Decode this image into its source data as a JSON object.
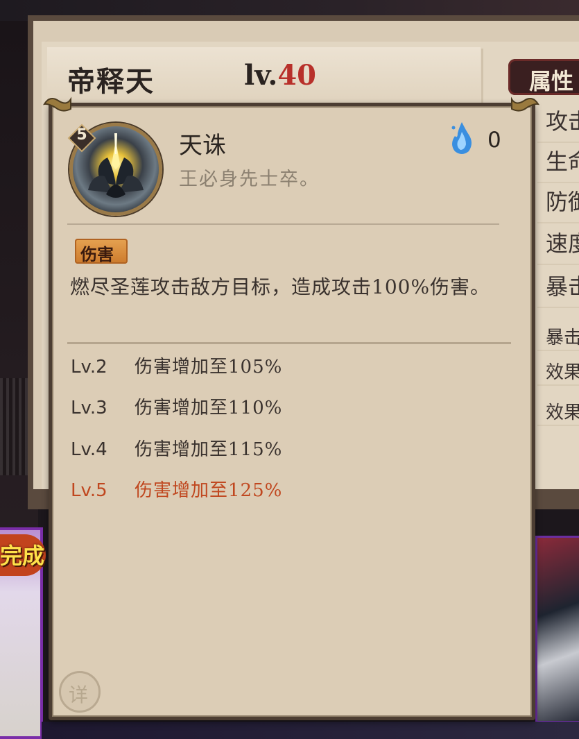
{
  "hero": {
    "name": "帝释天",
    "level_prefix": "lv.",
    "level_value": "40"
  },
  "attributes_tab": {
    "label": "属性"
  },
  "attributes": [
    "攻击",
    "生命",
    "防御",
    "速度",
    "暴击",
    "暴击伤害",
    "效果命中",
    "效果抵抗"
  ],
  "skill": {
    "level_badge": "5",
    "name": "天诛",
    "quote": "王必身先士卒。",
    "cost": "0",
    "tag": "伤害",
    "description": "燃尽圣莲攻击敌方目标，造成攻击100%伤害。",
    "upgrades": [
      {
        "level": "Lv.2",
        "effect": "伤害增加至105%"
      },
      {
        "level": "Lv.3",
        "effect": "伤害增加至110%"
      },
      {
        "level": "Lv.4",
        "effect": "伤害增加至115%"
      },
      {
        "level": "Lv.5",
        "effect": "伤害增加至125%",
        "current": true
      }
    ],
    "detail_button": "详"
  },
  "side_cards": {
    "left_badge": "完成"
  },
  "colors": {
    "highlight_red": "#b8302a",
    "current_level_orange": "#c0471f",
    "popup_bg": "#dccdb6"
  }
}
